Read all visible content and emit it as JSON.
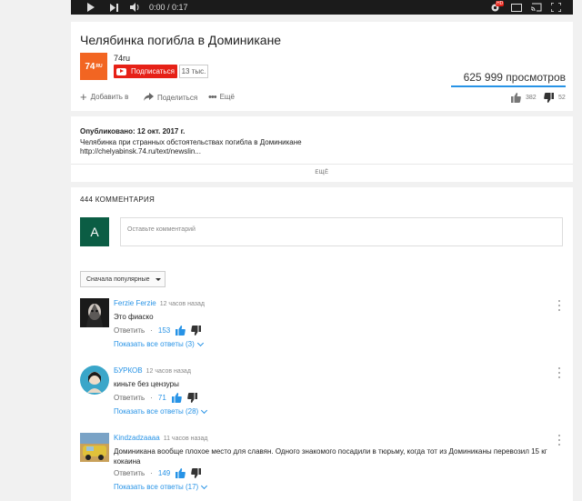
{
  "player": {
    "time": "0:00 / 0:17"
  },
  "video": {
    "title": "Челябинка погибла в Доминикане",
    "channel": "74ru",
    "logo_text": "74",
    "logo_suffix": "RU",
    "subscribe_label": "Подписаться",
    "subscriber_count": "13 тыс.",
    "views": "625 999 просмотров",
    "actions": {
      "add": "Добавить в",
      "share": "Поделиться",
      "more": "Ещё"
    },
    "likes": "382",
    "dislikes": "52"
  },
  "description": {
    "published": "Опубликовано: 12 окт. 2017 г.",
    "line1": "Челябинка при странных обстоятельствах погибла в Доминикане",
    "line2": "http://chelyabinsk.74.ru/text/newslin...",
    "more_label": "ЕЩЁ"
  },
  "comments_section": {
    "count_label": "444 КОММЕНТАРИЯ",
    "user_initial": "A",
    "input_placeholder": "Оставьте комментарий",
    "sort_label": "Сначала популярные",
    "reply_label": "Ответить",
    "items": [
      {
        "author": "Ferzie Ferzie",
        "time": "12 часов назад",
        "text": "Это фиаско",
        "likes": "153",
        "show_replies": "Показать все ответы (3)"
      },
      {
        "author": "БУРКОВ",
        "time": "12 часов назад",
        "text": "киньте без цензуры",
        "likes": "71",
        "show_replies": "Показать все ответы (28)"
      },
      {
        "author": "Kindzadzaaaa",
        "time": "11 часов назад",
        "text": "Доминикана вообще плохое место для славян. Одного знакомого посадили в тюрьму, когда тот из Доминиканы перевозил 15 кг кокаина",
        "likes": "149",
        "show_replies": "Показать все ответы (17)"
      }
    ]
  },
  "colors": {
    "accent": "#2793e6",
    "subscribe": "#e62117",
    "logo": "#f26522",
    "avatar": "#0b5d44"
  }
}
